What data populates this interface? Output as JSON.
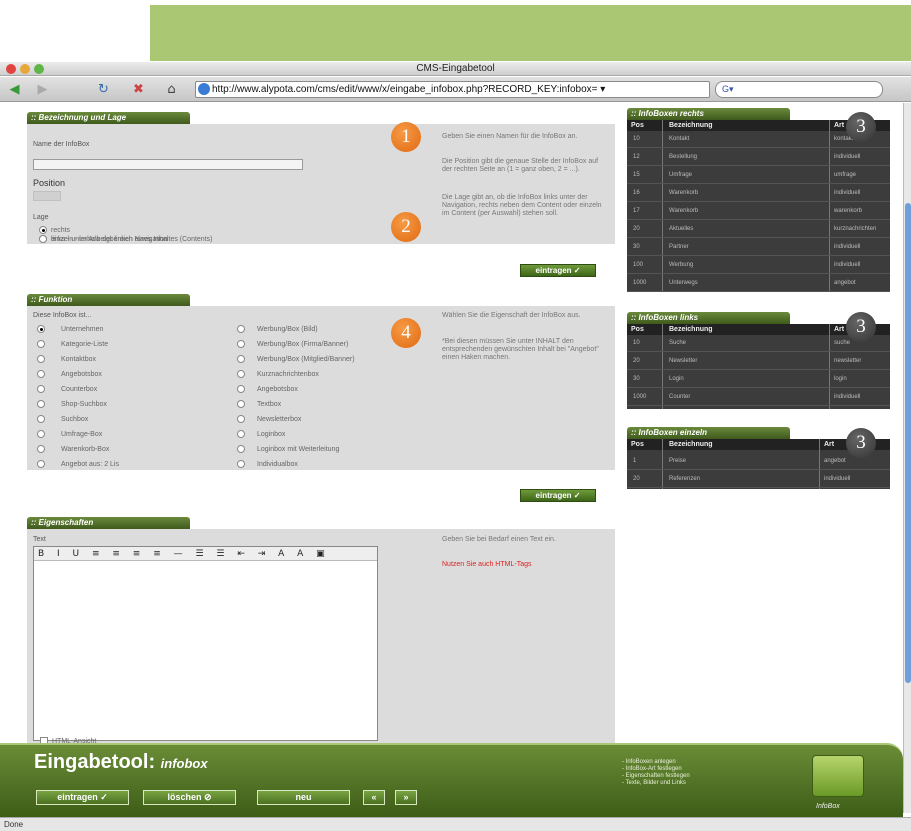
{
  "window": {
    "title": "CMS-Eingabetool"
  },
  "browser": {
    "url": "http://www.alypota.com/cms/edit/www/x/eingabe_infobox.php?RECORD_KEY:infobox= ▾",
    "search_placeholder": "G▾",
    "status": "Done"
  },
  "bezeichnung": {
    "tab": ":: Bezeichnung und Lage",
    "name_label": "Name der InfoBox",
    "position_label": "Position",
    "lage_label": "Lage",
    "lage_options": [
      "rechts",
      "links - unterhalb der linken Navigation",
      "einzeln - im Anzeigbereich eines Inhaltes (Contents)"
    ],
    "help_name": "Geben Sie einen Namen für die InfoBox an.",
    "help_position": "Die Position gibt die genaue Stelle der InfoBox auf der rechten Seite an (1 = ganz oben, 2 = ...).",
    "help_lage": "Die Lage gibt an, ob die InfoBox links unter der Navigation, rechts neben dem Content oder einzeln im Content (per Auswahl) stehen soll.",
    "submit": "eintragen ✓"
  },
  "funktion": {
    "tab": ":: Funktion",
    "label": "Diese InfoBox ist...",
    "left_options": [
      "Unternehmen",
      "Kategorie-Liste",
      "Kontaktbox",
      "Angebotsbox",
      "Counterbox",
      "Shop-Suchbox",
      "Suchbox",
      "Umfrage-Box",
      "Warenkorb-Box",
      "Angebot aus: 2 Lis"
    ],
    "right_options": [
      "Werbung/Box (Bild)",
      "Werbung/Box (Firma/Banner)",
      "Werbung/Box (Mitglied/Banner)",
      "Kurznachrichtenbox",
      "Angebotsbox",
      "Textbox",
      "Newsletterbox",
      "Loginbox",
      "Loginbox mit Weiterleitung",
      "Individualbox"
    ],
    "help": "Wählen Sie die Eigenschaft der InfoBox aus.",
    "help2": "*Bei diesen müssen Sie unter INHALT den entsprechenden gewünschten Inhalt bei \"Angebot\" einen Haken machen.",
    "submit": "eintragen ✓"
  },
  "eigenschaften": {
    "tab": ":: Eigenschaften",
    "text_label": "Text",
    "toolbar_glyphs": "B I U ≡ ≡ ≡ ≡ — ☰ ☰ ⇤ ⇥ A A ▣",
    "help": "Geben Sie bei Bedarf einen Text ein.",
    "help_link": "Nutzen Sie auch HTML-Tags",
    "html_label": "HTML-Ansicht"
  },
  "infoboxen_rechts": {
    "tab": ":: InfoBoxen rechts",
    "headers": [
      "Pos",
      "Bezeichnung",
      "Art"
    ],
    "rows": [
      [
        "10",
        "Kontakt",
        "kontakt"
      ],
      [
        "12",
        "Bestellung",
        "individuell"
      ],
      [
        "15",
        "Umfrage",
        "umfrage"
      ],
      [
        "16",
        "Warenkorb",
        "individuell"
      ],
      [
        "17",
        "Warenkorb",
        "warenkorb"
      ],
      [
        "20",
        "Aktuelles",
        "kurznachrichten"
      ],
      [
        "30",
        "Partner",
        "individuell"
      ],
      [
        "100",
        "Werbung",
        "individuell"
      ],
      [
        "1000",
        "Unterwegs",
        "angebot"
      ]
    ]
  },
  "infoboxen_links": {
    "tab": ":: InfoBoxen links",
    "headers": [
      "Pos",
      "Bezeichnung",
      "Art"
    ],
    "rows": [
      [
        "10",
        "Suche",
        "suche"
      ],
      [
        "20",
        "Newsletter",
        "newsletter"
      ],
      [
        "30",
        "Login",
        "login"
      ],
      [
        "1000",
        "Counter",
        "individuell"
      ]
    ]
  },
  "infoboxen_einzeln": {
    "tab": ":: InfoBoxen einzeln",
    "headers": [
      "Pos",
      "Bezeichnung",
      "Art"
    ],
    "rows": [
      [
        "1",
        "Preise",
        "angebot"
      ],
      [
        "20",
        "Referenzen",
        "individuell"
      ]
    ]
  },
  "badges": [
    "1",
    "2",
    "3",
    "4"
  ],
  "footer": {
    "title": "Eingabetool:",
    "subtitle": "infobox",
    "buttons": [
      "eintragen ✓",
      "löschen ⊘",
      "neu",
      "«",
      "»"
    ],
    "help": "- InfoBoxen anlegen\n- InfoBox-Art festlegen\n- Eigenschaften festlegen\n- Texte, Bilder und Links",
    "box_label": "InfoBox"
  }
}
